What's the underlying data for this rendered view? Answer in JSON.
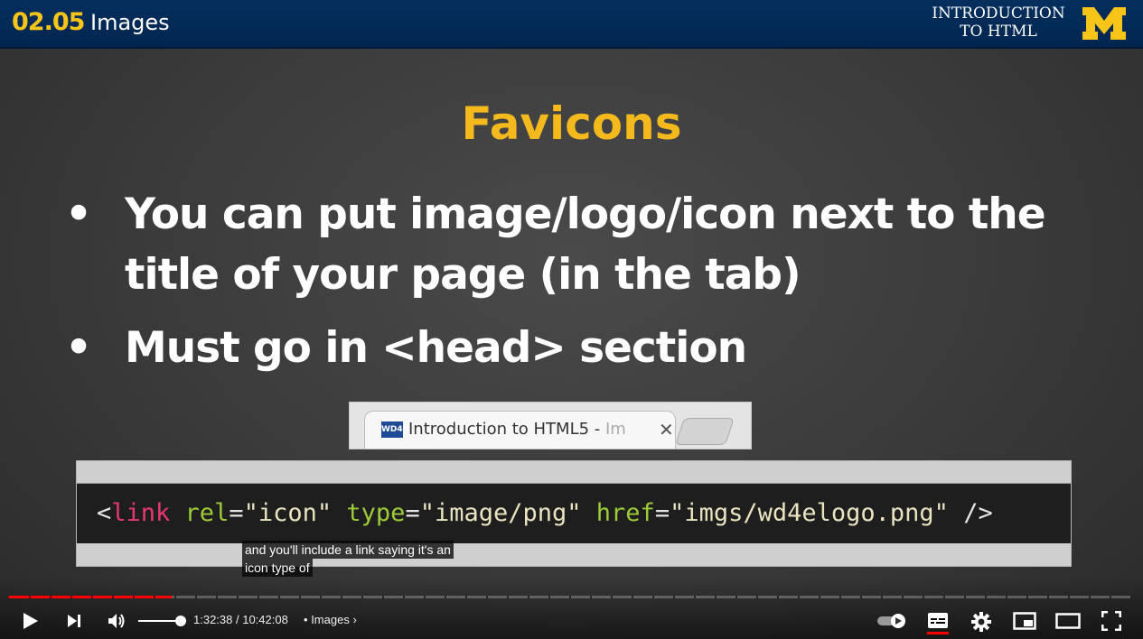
{
  "header": {
    "lesson_number": "02.05",
    "lesson_title": "Images",
    "course_title_line1": "INTRODUCTION",
    "course_title_line2": "TO HTML",
    "logo_icon": "block-m-logo",
    "colors": {
      "bar": "#00264f",
      "accent": "#f7c418"
    }
  },
  "slide": {
    "title": "Favicons",
    "bullets": [
      {
        "marker": "•",
        "lines": [
          "You can put image/logo/icon next to the",
          "title of your page (in the tab)"
        ]
      },
      {
        "marker": "•",
        "lines": [
          "Must go in <head> section"
        ]
      }
    ],
    "browser_tab": {
      "favicon_text": "WD4E",
      "label": "Introduction to HTML5 - ",
      "label_faded": "Im",
      "close_glyph": "✕"
    },
    "code": {
      "open": "<",
      "tag": "link",
      "attr1": " rel",
      "eq1": "=",
      "val1": "\"icon\"",
      "attr2": " type",
      "eq2": "=",
      "val2": "\"image/png\"",
      "attr3": " href",
      "eq3": "=",
      "val3": "\"imgs/wd4elogo.png\"",
      "close": " />"
    }
  },
  "caption": {
    "line1": "and you'll include a link saying it's an",
    "line2": "icon type of"
  },
  "player": {
    "progress_fraction": 0.1446,
    "current_time": "1:32:38",
    "separator": " / ",
    "duration": "10:42:08",
    "chapter_dot": "•",
    "chapter_title": "Images",
    "chapter_chevron": "›",
    "volume_level": 1.0,
    "icons": [
      "play-icon",
      "next-icon",
      "volume-icon",
      "autoplay-toggle-icon",
      "subtitles-icon",
      "settings-gear-icon",
      "miniplayer-icon",
      "theater-mode-icon",
      "fullscreen-icon"
    ],
    "progress_color": "#ff0000"
  }
}
